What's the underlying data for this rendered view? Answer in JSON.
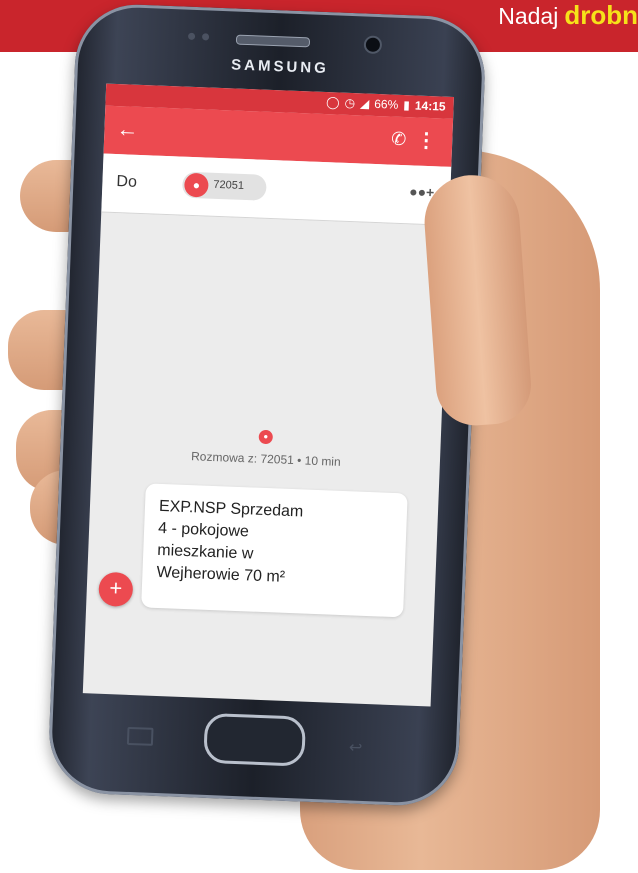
{
  "banner": {
    "text_prefix": "Nadaj",
    "text_highlight": "drobn"
  },
  "phone": {
    "brand": "SAMSUNG"
  },
  "status_bar": {
    "battery": "66%",
    "time": "14:15"
  },
  "app_bar": {
    "back_icon": "arrow-left-icon",
    "call_icon": "phone-icon",
    "more_icon": "more-vertical-icon"
  },
  "recipient": {
    "label": "Do",
    "chip_number": "72051",
    "add_icon": "add-contact-icon"
  },
  "conversation": {
    "info": "Rozmowa z: 72051 • 10 min",
    "message": "EXP.NSP Sprzedam\n4 - pokojowe\nmieszkanie w\nWejherowie 70 m²"
  },
  "colors": {
    "banner": "#c9252c",
    "highlight": "#f6e21a",
    "app_bar": "#ec4a50",
    "status_bar": "#d8363d"
  }
}
